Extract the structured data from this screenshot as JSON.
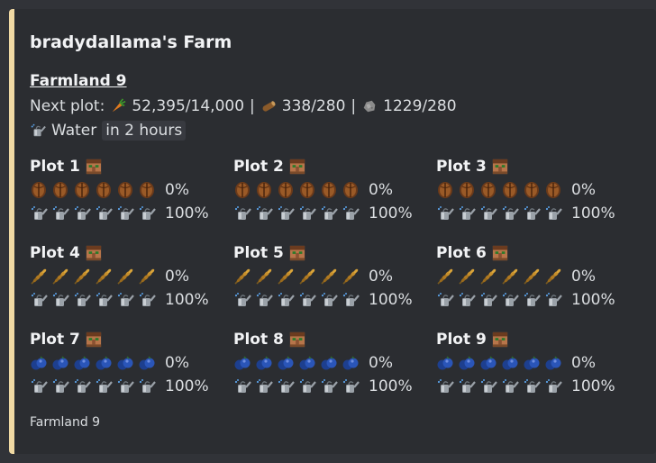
{
  "embed": {
    "accent_color": "#f0d9a3",
    "title": "bradydallama's Farm",
    "farmland_link": "Farmland 9",
    "next_plot_label": "Next plot:",
    "costs": [
      {
        "icon": "carrot-icon",
        "value": "52,395/14,000"
      },
      {
        "icon": "log-icon",
        "value": "338/280"
      },
      {
        "icon": "stone-icon",
        "value": "1229/280"
      }
    ],
    "separator": "|",
    "water_label": "Water",
    "water_time": "in 2 hours",
    "footer": "Farmland 9"
  },
  "plots": [
    {
      "name": "Plot 1",
      "crop": "cocoa-bean-icon",
      "growth": "0%",
      "water": "100%"
    },
    {
      "name": "Plot 2",
      "crop": "cocoa-bean-icon",
      "growth": "0%",
      "water": "100%"
    },
    {
      "name": "Plot 3",
      "crop": "cocoa-bean-icon",
      "growth": "0%",
      "water": "100%"
    },
    {
      "name": "Plot 4",
      "crop": "wheat-icon",
      "growth": "0%",
      "water": "100%"
    },
    {
      "name": "Plot 5",
      "crop": "wheat-icon",
      "growth": "0%",
      "water": "100%"
    },
    {
      "name": "Plot 6",
      "crop": "wheat-icon",
      "growth": "0%",
      "water": "100%"
    },
    {
      "name": "Plot 7",
      "crop": "blueberry-icon",
      "growth": "0%",
      "water": "100%"
    },
    {
      "name": "Plot 8",
      "crop": "blueberry-icon",
      "growth": "0%",
      "water": "100%"
    },
    {
      "name": "Plot 9",
      "crop": "blueberry-icon",
      "growth": "0%",
      "water": "100%"
    }
  ]
}
